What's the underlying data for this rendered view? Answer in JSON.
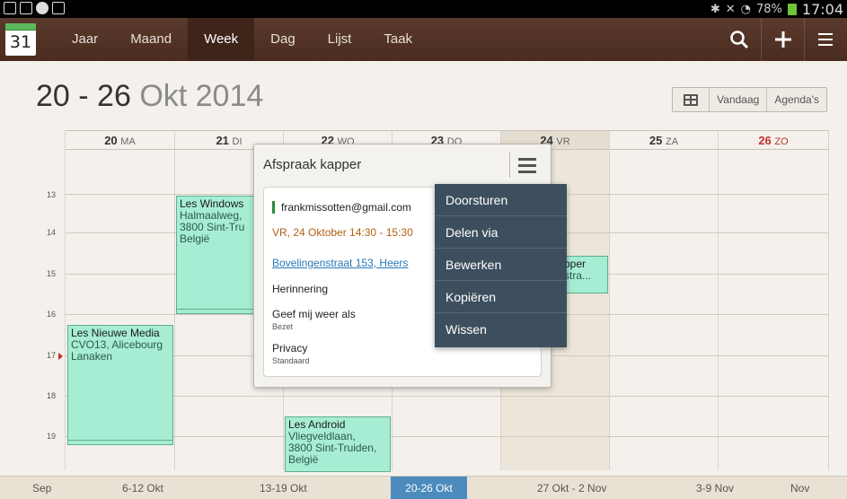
{
  "status_bar": {
    "battery": "78%",
    "time": "17:04"
  },
  "app": {
    "icon_day": "31",
    "tabs": [
      "Jaar",
      "Maand",
      "Week",
      "Dag",
      "Lijst",
      "Taak"
    ],
    "active_tab": "Week",
    "actions": [
      "search-icon",
      "add-icon",
      "menu-icon"
    ]
  },
  "header": {
    "range": "20 - 26",
    "month_year": "Okt 2014",
    "buttons": {
      "today": "Vandaag",
      "calendars": "Agenda's"
    }
  },
  "days": [
    {
      "num": "20",
      "wd": "MA"
    },
    {
      "num": "21",
      "wd": "DI"
    },
    {
      "num": "22",
      "wd": "WO"
    },
    {
      "num": "23",
      "wd": "DO"
    },
    {
      "num": "24",
      "wd": "VR"
    },
    {
      "num": "25",
      "wd": "ZA"
    },
    {
      "num": "26",
      "wd": "ZO"
    }
  ],
  "hours": [
    "13",
    "14",
    "15",
    "16",
    "17",
    "18",
    "19"
  ],
  "events": {
    "windows": {
      "title": "Les Windows",
      "l1": "Halmaalweg,",
      "l2": "3800 Sint-Tru",
      "l3": "België"
    },
    "media": {
      "title": "Les Nieuwe Media",
      "l1": "CVO13, Alicebourg",
      "l2": "Lanaken"
    },
    "android": {
      "title": "Les Android",
      "l1": "Vliegveldlaan,",
      "l2": "3800 Sint-Truiden,",
      "l3": "België"
    },
    "kapper": {
      "title": "pper",
      "l1": "stra..."
    }
  },
  "popup": {
    "title": "Afspraak kapper",
    "email": "frankmissotten@gmail.com",
    "when": "VR, 24 Oktober 14:30 - 15:30",
    "address": "Bovelingenstraat 153, Heers",
    "reminder_label": "Herinnering",
    "show_as_label": "Geef mij weer als",
    "show_as_value": "Bezet",
    "privacy_label": "Privacy",
    "privacy_value": "Standaard"
  },
  "context_menu": [
    "Doorsturen",
    "Delen via",
    "Bewerken",
    "Kopiëren",
    "Wissen"
  ],
  "timeline": [
    "Sep",
    "6-12 Okt",
    "13-19 Okt",
    "20-26 Okt",
    "27 Okt - 2 Nov",
    "3-9 Nov",
    "Nov"
  ],
  "colors": {
    "accent": "#4b8bbd",
    "event_bg": "#a6edd3",
    "appbar": "#4a2c20",
    "sunday": "#c0302a"
  }
}
